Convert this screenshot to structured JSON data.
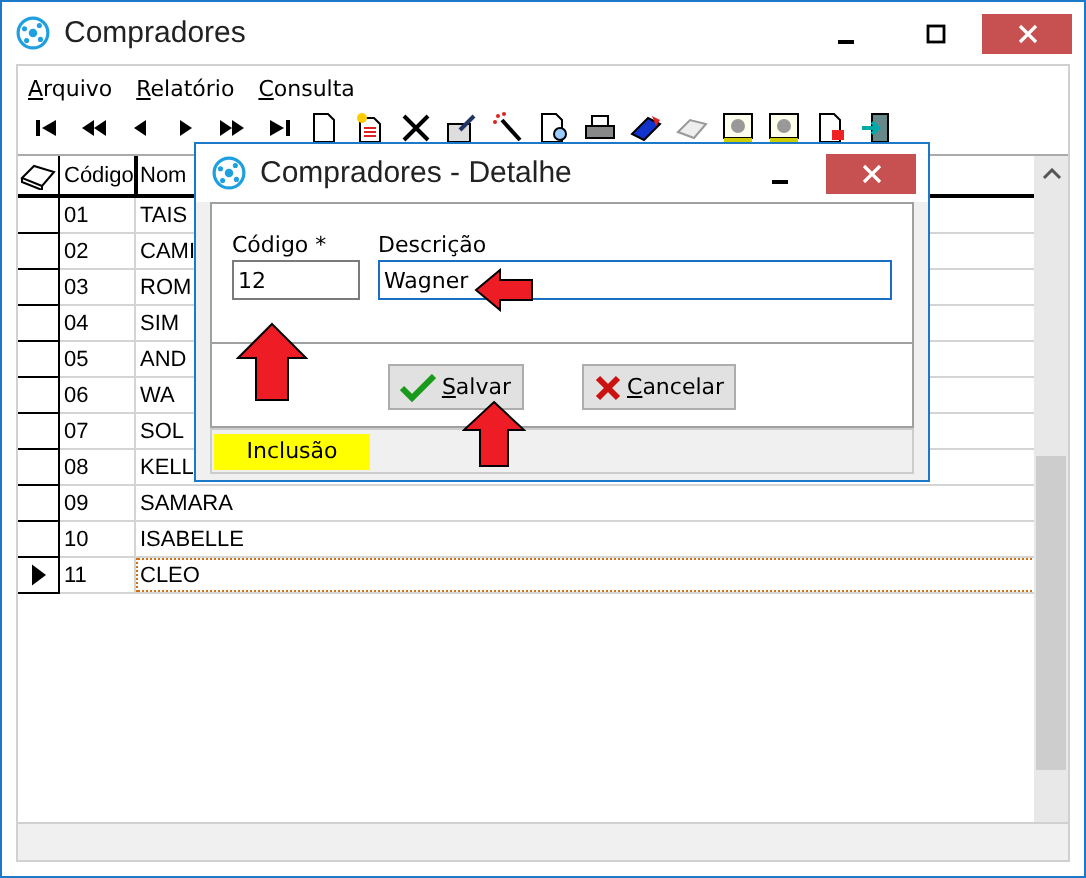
{
  "window": {
    "title": "Compradores"
  },
  "menu": [
    "Arquivo",
    "Relatório",
    "Consulta"
  ],
  "grid": {
    "columns": [
      "Código",
      "Nom"
    ],
    "rows": [
      {
        "code": "01",
        "name": "TAIS",
        "selected": false
      },
      {
        "code": "02",
        "name": "CAMI",
        "selected": false
      },
      {
        "code": "03",
        "name": "ROM",
        "selected": false
      },
      {
        "code": "04",
        "name": "SIM",
        "selected": false
      },
      {
        "code": "05",
        "name": "AND",
        "selected": false
      },
      {
        "code": "06",
        "name": "WA",
        "selected": false
      },
      {
        "code": "07",
        "name": "SOL",
        "selected": false
      },
      {
        "code": "08",
        "name": "KELL",
        "selected": false
      },
      {
        "code": "09",
        "name": "SAMARA",
        "selected": false
      },
      {
        "code": "10",
        "name": "ISABELLE",
        "selected": false
      },
      {
        "code": "11",
        "name": "CLEO",
        "selected": true
      }
    ]
  },
  "dialog": {
    "title": "Compradores - Detalhe",
    "fields": [
      {
        "label": "Código *",
        "value": "12",
        "focused": false
      },
      {
        "label": "Descrição",
        "value": "Wagner",
        "focused": true
      }
    ],
    "buttons": [
      {
        "kind": "save",
        "label": "Salvar"
      },
      {
        "kind": "cancel",
        "label": "Cancelar"
      }
    ],
    "status": "Inclusão"
  }
}
